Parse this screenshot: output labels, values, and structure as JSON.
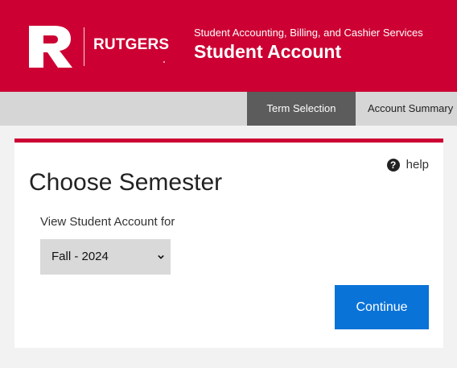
{
  "header": {
    "logo_wordmark": "RUTGERS",
    "department": "Student Accounting, Billing, and Cashier Services",
    "app_title": "Student Account"
  },
  "nav": {
    "tabs": [
      {
        "label": "Term Selection",
        "active": true
      },
      {
        "label": "Account Summary",
        "active": false
      }
    ]
  },
  "card": {
    "help_label": "help",
    "help_icon": "question-circle-icon",
    "title": "Choose Semester",
    "field_label": "View Student Account for",
    "term_select": {
      "selected": "Fall - 2024"
    },
    "continue_label": "Continue"
  },
  "colors": {
    "brand_red": "#cc0033",
    "nav_active": "#5c5c5c",
    "button_blue": "#0a73d8"
  }
}
